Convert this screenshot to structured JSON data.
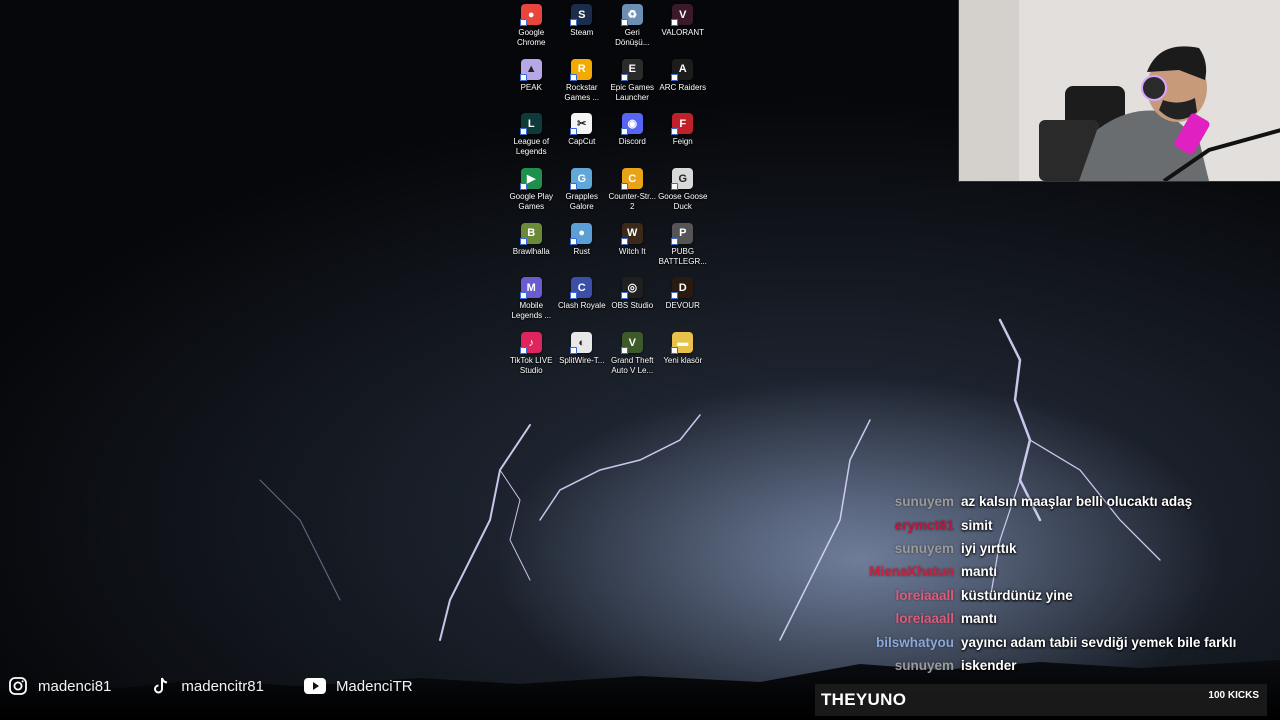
{
  "desktop": {
    "icons": [
      {
        "label": "Google Chrome",
        "icon": "chrome-icon",
        "color": "#e8453c",
        "glyph": "●"
      },
      {
        "label": "Steam",
        "icon": "steam-icon",
        "color": "#1b2d4a",
        "glyph": "S"
      },
      {
        "label": "Geri Dönüşü...",
        "icon": "recycle-bin-icon",
        "color": "#6d8fb3",
        "glyph": "♻"
      },
      {
        "label": "VALORANT",
        "icon": "valorant-icon",
        "color": "#3a1a2a",
        "glyph": "V"
      },
      {
        "label": "PEAK",
        "icon": "peak-icon",
        "color": "#b7a7e6",
        "glyph": "▲"
      },
      {
        "label": "Rockstar Games ...",
        "icon": "rockstar-icon",
        "color": "#f2a900",
        "glyph": "R"
      },
      {
        "label": "Epic Games Launcher",
        "icon": "epic-games-icon",
        "color": "#2b2b2b",
        "glyph": "E"
      },
      {
        "label": "ARC Raiders",
        "icon": "arc-raiders-icon",
        "color": "#1c1c1c",
        "glyph": "A"
      },
      {
        "label": "League of Legends",
        "icon": "league-of-legends-icon",
        "color": "#0e3a3a",
        "glyph": "L"
      },
      {
        "label": "CapCut",
        "icon": "capcut-icon",
        "color": "#f4f4f4",
        "glyph": "✂"
      },
      {
        "label": "Discord",
        "icon": "discord-icon",
        "color": "#5865f2",
        "glyph": "◉"
      },
      {
        "label": "Feign",
        "icon": "feign-icon",
        "color": "#c0202a",
        "glyph": "F"
      },
      {
        "label": "Google Play Games",
        "icon": "google-play-games-icon",
        "color": "#1f8f4e",
        "glyph": "▶"
      },
      {
        "label": "Grapples Galore",
        "icon": "grapples-galore-icon",
        "color": "#5fa8d8",
        "glyph": "G"
      },
      {
        "label": "Counter-Str... 2",
        "icon": "counter-strike-icon",
        "color": "#e8a317",
        "glyph": "C"
      },
      {
        "label": "Goose Goose Duck",
        "icon": "goose-goose-duck-icon",
        "color": "#d9d9d9",
        "glyph": "G"
      },
      {
        "label": "Brawlhalla",
        "icon": "brawlhalla-icon",
        "color": "#6a8a3a",
        "glyph": "B"
      },
      {
        "label": "Rust",
        "icon": "rust-icon",
        "color": "#5c9fd6",
        "glyph": "●"
      },
      {
        "label": "Witch It",
        "icon": "witch-it-icon",
        "color": "#3b2a1a",
        "glyph": "W"
      },
      {
        "label": "PUBG BATTLEGR...",
        "icon": "pubg-icon",
        "color": "#555555",
        "glyph": "P"
      },
      {
        "label": "Mobile Legends ...",
        "icon": "mobile-legends-icon",
        "color": "#6a5bd0",
        "glyph": "M"
      },
      {
        "label": "Clash Royale",
        "icon": "clash-royale-icon",
        "color": "#3b4fa8",
        "glyph": "C"
      },
      {
        "label": "OBS Studio",
        "icon": "obs-studio-icon",
        "color": "#202020",
        "glyph": "◎"
      },
      {
        "label": "DEVOUR",
        "icon": "devour-icon",
        "color": "#2a1a10",
        "glyph": "D"
      },
      {
        "label": "TikTok LIVE Studio",
        "icon": "tiktok-live-studio-icon",
        "color": "#e0245e",
        "glyph": "♪"
      },
      {
        "label": "SplitWire-T...",
        "icon": "splitwire-icon",
        "color": "#e8e8e8",
        "glyph": "◐"
      },
      {
        "label": "Grand Theft Auto V Le...",
        "icon": "gta-v-icon",
        "color": "#3c5a2a",
        "glyph": "V"
      },
      {
        "label": "Yeni klasör",
        "icon": "folder-icon",
        "color": "#e8c04a",
        "glyph": "▬"
      }
    ]
  },
  "chat": {
    "messages": [
      {
        "user": "sunuyem",
        "user_color": "#9a9a9a",
        "message": "az kalsın maaşlar belli olucaktı adaş"
      },
      {
        "user": "erymct81",
        "user_color": "#c0143c",
        "message": "simit"
      },
      {
        "user": "sunuyem",
        "user_color": "#9a9a9a",
        "message": "iyi yırttık"
      },
      {
        "user": "MienaKhatun",
        "user_color": "#d01e3c",
        "message": "mantı"
      },
      {
        "user": "loreiaaall",
        "user_color": "#e05a7a",
        "message": "küstürdünüz yine"
      },
      {
        "user": "loreiaaall",
        "user_color": "#e05a7a",
        "message": "mantı"
      },
      {
        "user": "bilswhatyou",
        "user_color": "#8aa8d8",
        "message": "yayıncı adam tabii sevdiği yemek bile farklı"
      },
      {
        "user": "sunuyem",
        "user_color": "#9a9a9a",
        "message": "iskender"
      }
    ]
  },
  "subs": {
    "latest": "THEYUNO",
    "goal": "100 KICKS"
  },
  "socials": [
    {
      "icon": "instagram-icon",
      "handle": "madenci81"
    },
    {
      "icon": "tiktok-icon",
      "handle": "madencitr81"
    },
    {
      "icon": "youtube-icon",
      "handle": "MadenciTR"
    }
  ]
}
